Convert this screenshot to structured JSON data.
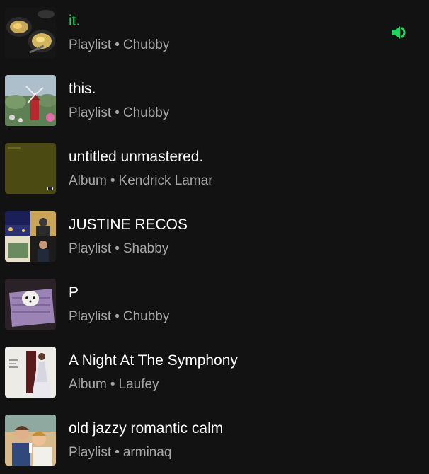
{
  "library": {
    "items": [
      {
        "title": "it.",
        "type": "Playlist",
        "owner": "Chubby",
        "playing": true,
        "cover": "eggs-pan"
      },
      {
        "title": "this.",
        "type": "Playlist",
        "owner": "Chubby",
        "playing": false,
        "cover": "windmill-garden"
      },
      {
        "title": "untitled unmastered.",
        "type": "Album",
        "owner": "Kendrick Lamar",
        "playing": false,
        "cover": "olive-green"
      },
      {
        "title": "JUSTINE RECOS",
        "type": "Playlist",
        "owner": "Shabby",
        "playing": false,
        "cover": "collage"
      },
      {
        "title": "P",
        "type": "Playlist",
        "owner": "Chubby",
        "playing": false,
        "cover": "dog-basket"
      },
      {
        "title": "A Night At The Symphony",
        "type": "Album",
        "owner": "Laufey",
        "playing": false,
        "cover": "white-dress"
      },
      {
        "title": "old jazzy romantic calm",
        "type": "Playlist",
        "owner": "arminaq",
        "playing": false,
        "cover": "vintage-couple"
      }
    ],
    "separator": "•",
    "accent_color": "#1ed760",
    "playing_icon": "speaker-volume-icon"
  }
}
